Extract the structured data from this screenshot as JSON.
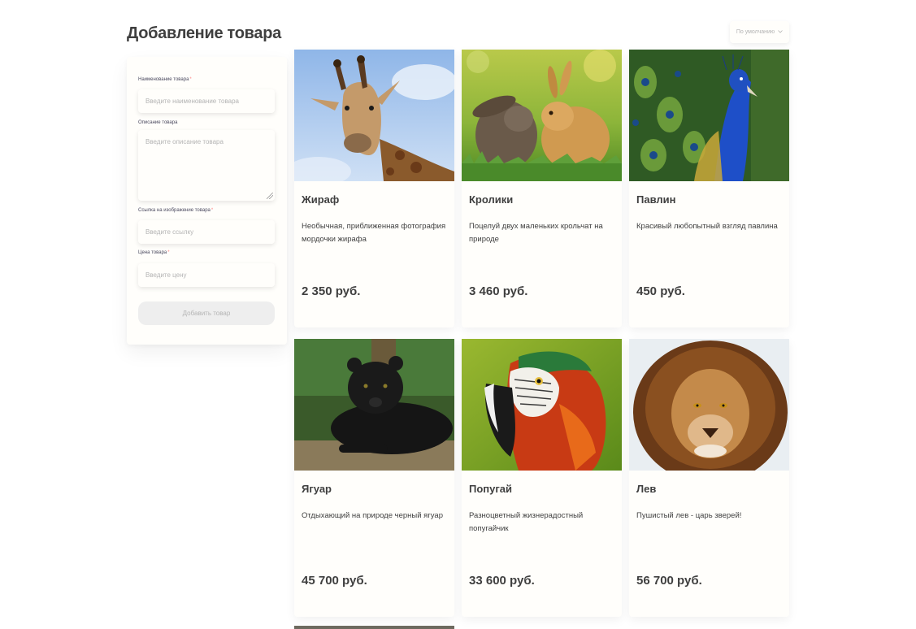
{
  "page": {
    "title": "Добавление товара"
  },
  "sort": {
    "label": "По умолчанию",
    "icon": "chevron-down-icon"
  },
  "form": {
    "name_label": "Наименование товара",
    "name_placeholder": "Введите наименование товара",
    "description_label": "Описание товара",
    "description_placeholder": "Введите описание товара",
    "image_label": "Ссылка на изображение товара",
    "image_placeholder": "Введите ссылку",
    "price_label": "Цена товара",
    "price_placeholder": "Введите цену",
    "required_mark": "*",
    "submit_label": "Добавить товар"
  },
  "products": [
    {
      "name": "Жираф",
      "description": "Необычная, приближенная фотография мордочки жирафа",
      "price": "2 350 руб.",
      "image": "giraffe-photo"
    },
    {
      "name": "Кролики",
      "description": "Поцелуй двух маленьких крольчат на природе",
      "price": "3 460 руб.",
      "image": "rabbits-photo"
    },
    {
      "name": "Павлин",
      "description": "Красивый любопытный взгляд павлина",
      "price": "450 руб.",
      "image": "peacock-photo"
    },
    {
      "name": "Ягуар",
      "description": "Отдыхающий на природе черный ягуар",
      "price": "45 700 руб.",
      "image": "jaguar-photo"
    },
    {
      "name": "Попугай",
      "description": "Разноцветный жизнерадостный попугайчик",
      "price": "33 600 руб.",
      "image": "parrot-photo"
    },
    {
      "name": "Лев",
      "description": "Пушистый лев - царь зверей!",
      "price": "56 700 руб.",
      "image": "lion-photo"
    }
  ],
  "colors": {
    "background": "#ffffff",
    "card": "#fffefb",
    "text": "#3f3f3f",
    "required": "#ff8484",
    "placeholder": "#b4b4b4",
    "button_disabled": "#eeeeee"
  }
}
